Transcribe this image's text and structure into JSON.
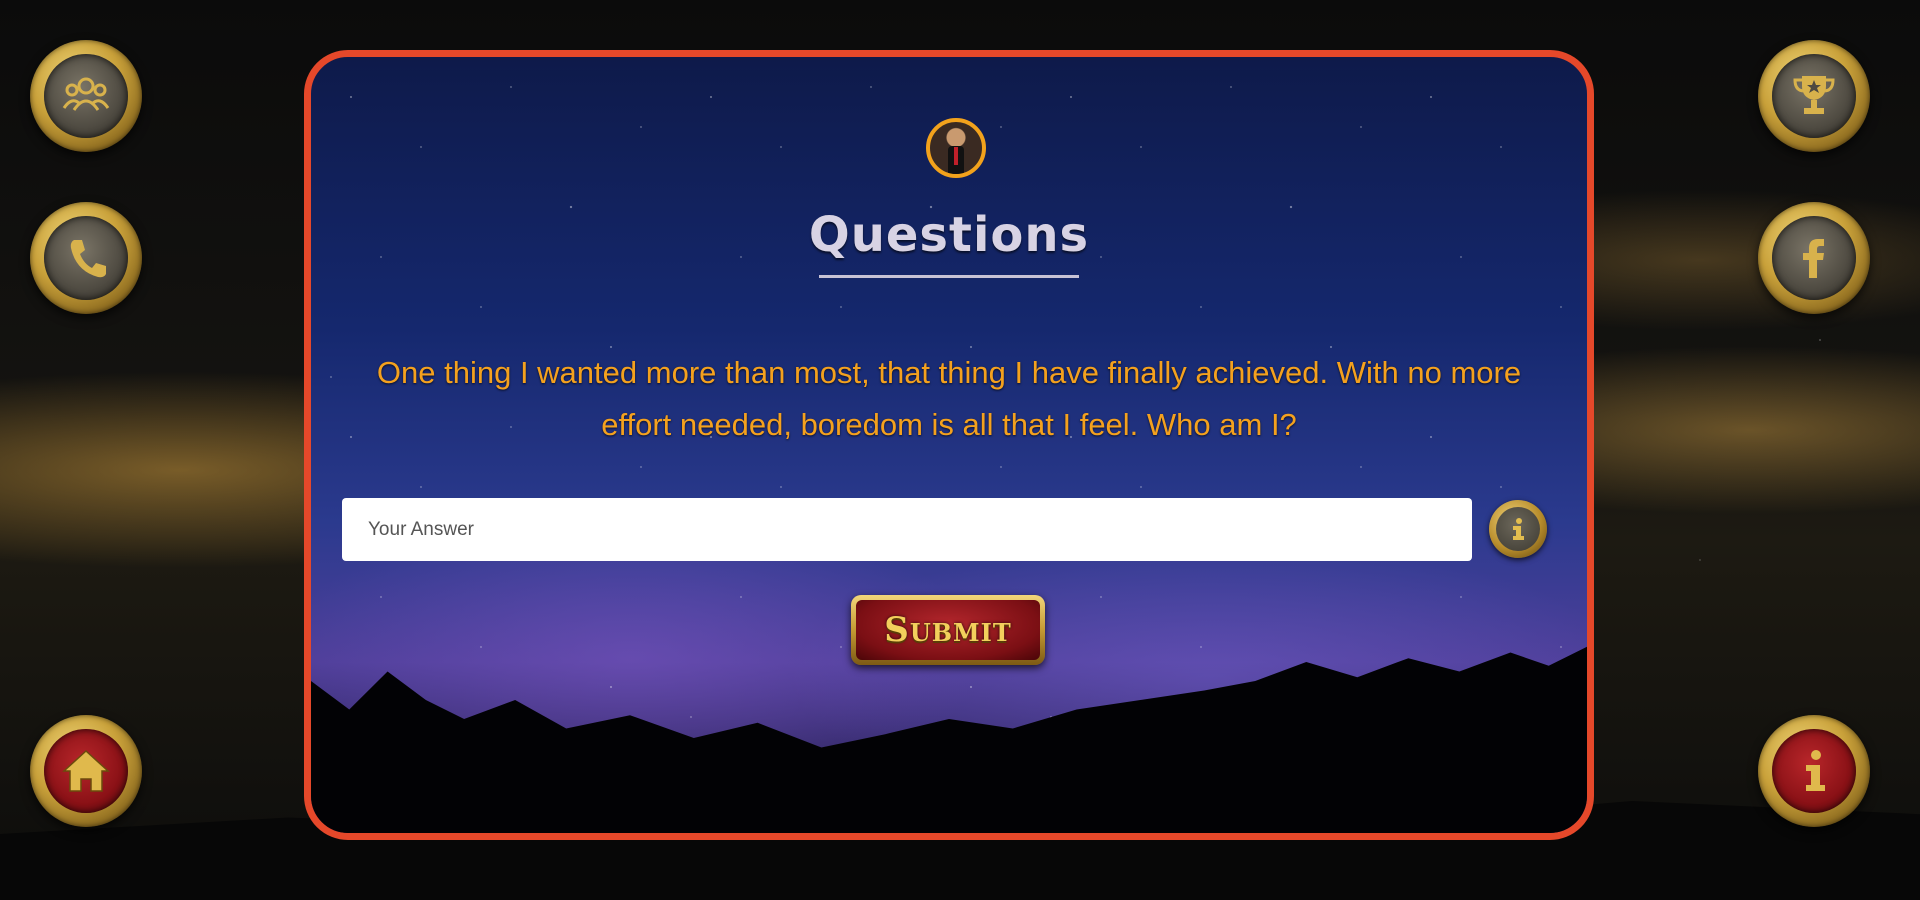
{
  "page": {
    "title": "Questions",
    "question": "One thing I wanted more than most, that thing I have finally achieved. With no more effort needed, boredom is all that I feel. Who am I?",
    "answer_input": {
      "value": "",
      "placeholder": "Your Answer"
    },
    "submit_label": "Submit"
  },
  "nav": {
    "left": [
      "team-icon",
      "phone-icon",
      "home-icon"
    ],
    "right": [
      "trophy-icon",
      "facebook-icon",
      "info-icon"
    ]
  },
  "colors": {
    "accent_orange": "#f4a11e",
    "card_border": "#e5482a",
    "gold": "#c9a13a",
    "button_red": "#8a1116"
  }
}
